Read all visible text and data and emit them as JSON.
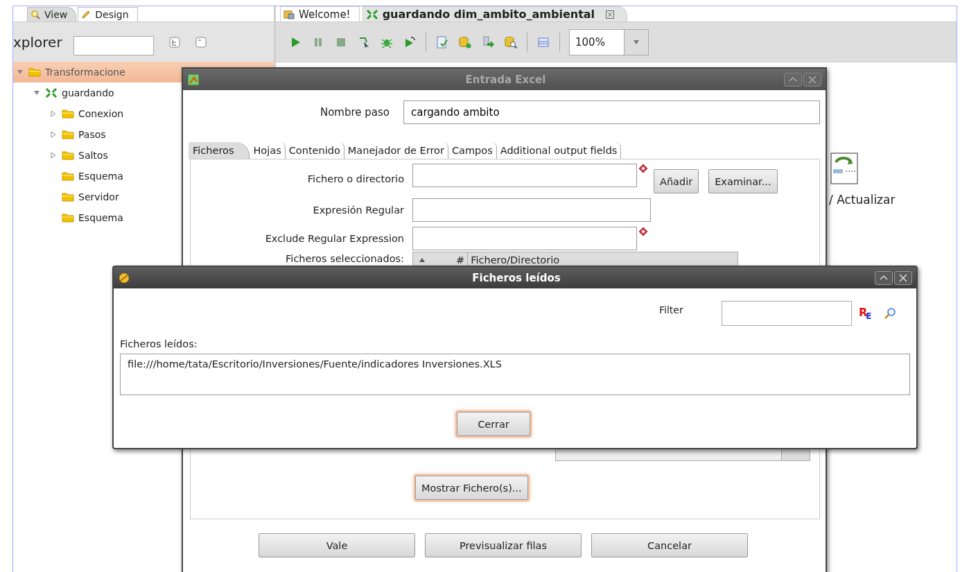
{
  "left_panel": {
    "tabs": [
      {
        "label": "View",
        "selected": true,
        "kind": "view"
      },
      {
        "label": "Design",
        "selected": false,
        "kind": "design"
      }
    ],
    "explorer": {
      "title": "xplorer"
    },
    "tree": [
      {
        "label": "Transformacione",
        "kind": "folder",
        "selected": true,
        "expanded": true,
        "children": [
          {
            "label": "guardando",
            "kind": "transformation",
            "selected": false,
            "expanded": true,
            "children": [
              {
                "label": "Conexion",
                "kind": "folder",
                "selected": false,
                "expanded": false
              },
              {
                "label": "Pasos",
                "kind": "folder",
                "selected": false,
                "expanded": false
              },
              {
                "label": "Saltos",
                "kind": "folder",
                "selected": false,
                "expanded": false
              },
              {
                "label": "Esquema",
                "kind": "folder",
                "selected": false
              },
              {
                "label": "Servidor",
                "kind": "folder",
                "selected": false
              },
              {
                "label": "Esquema",
                "kind": "folder",
                "selected": false
              }
            ]
          }
        ]
      }
    ]
  },
  "editor": {
    "tabs": [
      {
        "label": "Welcome!",
        "kind": "welcome",
        "selected": false,
        "closable": false
      },
      {
        "label": "guardando dim_ambito_ambiental",
        "kind": "transformation",
        "selected": true,
        "closable": true
      }
    ],
    "toolbar": {
      "zoom": "100%"
    },
    "canvas": {
      "label": "/ Actualizar"
    }
  },
  "entrada_excel": {
    "title": "Entrada Excel",
    "step_name": {
      "label": "Nombre paso",
      "value": "cargando ambito"
    },
    "tabs": [
      {
        "label": "Ficheros",
        "selected": true
      },
      {
        "label": "Hojas",
        "selected": false
      },
      {
        "label": "Contenido",
        "selected": false
      },
      {
        "label": "Manejador de Error",
        "selected": false
      },
      {
        "label": "Campos",
        "selected": false
      },
      {
        "label": "Additional output fields",
        "selected": false
      }
    ],
    "fields": [
      {
        "label": "Fichero o directorio",
        "required": true,
        "buttons": [
          {
            "label": "Añadir",
            "focused": false
          },
          {
            "label": "Examinar...",
            "focused": false
          }
        ]
      },
      {
        "label": "Expresión Regular",
        "required": false
      },
      {
        "label": "Exclude Regular Expression",
        "required": true
      }
    ],
    "selected_files": {
      "label": "Ficheros seleccionados:",
      "columns": [
        "#",
        "Fichero/Directorio"
      ]
    },
    "show_files_button": {
      "label": "Mostrar Fichero(s)...",
      "focused": true
    },
    "buttons": [
      {
        "label": "Vale",
        "focused": false
      },
      {
        "label": "Previsualizar filas",
        "focused": false
      },
      {
        "label": "Cancelar",
        "focused": false
      }
    ]
  },
  "ficheros_leidos": {
    "title": "Ficheros leídos",
    "filter": {
      "label": "Filter"
    },
    "regex_label": "R$_{E}$",
    "list_label": "Ficheros leídos:",
    "files": [
      "file:///home/tata/Escritorio/Inversiones/Fuente/indicadores Inversiones.XLS"
    ],
    "close_button": {
      "label": "Cerrar",
      "focused": true
    }
  }
}
